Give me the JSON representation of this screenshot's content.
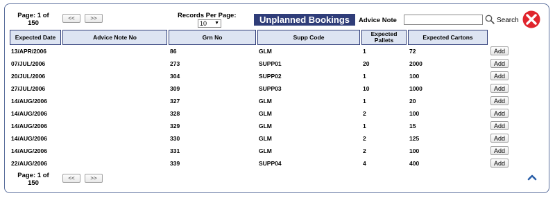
{
  "pager_top": {
    "page_text": "Page: 1 of",
    "total_pages": "150",
    "prev_label": "<<",
    "next_label": ">>"
  },
  "pager_bottom": {
    "page_text": "Page: 1 of",
    "total_pages": "150",
    "prev_label": "<<",
    "next_label": ">>"
  },
  "records_per_page": {
    "label": "Records Per Page:",
    "value": "10"
  },
  "title": "Unplanned Bookings",
  "advice_search": {
    "label": "Advice Note",
    "value": "",
    "button_label": "Search"
  },
  "icons": {
    "search": "search-icon",
    "close": "close-icon",
    "scroll_top": "chevron-up-icon"
  },
  "colors": {
    "title_bg": "#2f3d79",
    "header_bg": "#dde4f2",
    "close_red": "#e0252d",
    "frame_border": "#5a6e9c"
  },
  "table": {
    "headers": [
      "Expected Date",
      "Advice Note No",
      "Grn No",
      "Supp Code",
      "Expected Pallets",
      "Expected Cartons"
    ],
    "add_label": "Add",
    "rows": [
      {
        "date": "13/APR/2006",
        "advice": "",
        "grn": "86",
        "supp": "GLM",
        "pallets": "1",
        "cartons": "72"
      },
      {
        "date": "07/JUL/2006",
        "advice": "",
        "grn": "273",
        "supp": "SUPP01",
        "pallets": "20",
        "cartons": "2000"
      },
      {
        "date": "20/JUL/2006",
        "advice": "",
        "grn": "304",
        "supp": "SUPP02",
        "pallets": "1",
        "cartons": "100"
      },
      {
        "date": "27/JUL/2006",
        "advice": "",
        "grn": "309",
        "supp": "SUPP03",
        "pallets": "10",
        "cartons": "1000"
      },
      {
        "date": "14/AUG/2006",
        "advice": "",
        "grn": "327",
        "supp": "GLM",
        "pallets": "1",
        "cartons": "20"
      },
      {
        "date": "14/AUG/2006",
        "advice": "",
        "grn": "328",
        "supp": "GLM",
        "pallets": "2",
        "cartons": "100"
      },
      {
        "date": "14/AUG/2006",
        "advice": "",
        "grn": "329",
        "supp": "GLM",
        "pallets": "1",
        "cartons": "15"
      },
      {
        "date": "14/AUG/2006",
        "advice": "",
        "grn": "330",
        "supp": "GLM",
        "pallets": "2",
        "cartons": "125"
      },
      {
        "date": "14/AUG/2006",
        "advice": "",
        "grn": "331",
        "supp": "GLM",
        "pallets": "2",
        "cartons": "100"
      },
      {
        "date": "22/AUG/2006",
        "advice": "",
        "grn": "339",
        "supp": "SUPP04",
        "pallets": "4",
        "cartons": "400"
      }
    ]
  }
}
